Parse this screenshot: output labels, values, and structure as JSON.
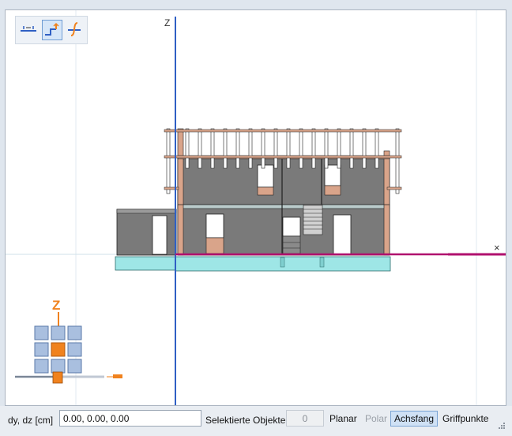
{
  "toolbar": {
    "buttons": [
      {
        "name": "level-icon",
        "active": false
      },
      {
        "name": "step-icon",
        "active": true
      },
      {
        "name": "curve-icon",
        "active": false
      }
    ]
  },
  "axes": {
    "vertical_label": "Z",
    "horizontal_end_mark": "×"
  },
  "nav_widget": {
    "axis_label": "Z"
  },
  "status": {
    "coord_label": "dy, dz [cm]",
    "coord_value": "0.00, 0.00, 0.00",
    "selected_label": "Selektierte Objekte",
    "selected_count": "0",
    "planar": "Planar",
    "polar": "Polar",
    "achsfang": "Achsfang",
    "griffpunkte": "Griffpunkte"
  },
  "colors": {
    "axis_blue": "#2f5fc4",
    "axis_magenta": "#b0106e",
    "foundation": "#9ee6e6",
    "wall": "#7a7a7a",
    "timber": "#d9a48a",
    "nav_orange": "#f0821e"
  }
}
